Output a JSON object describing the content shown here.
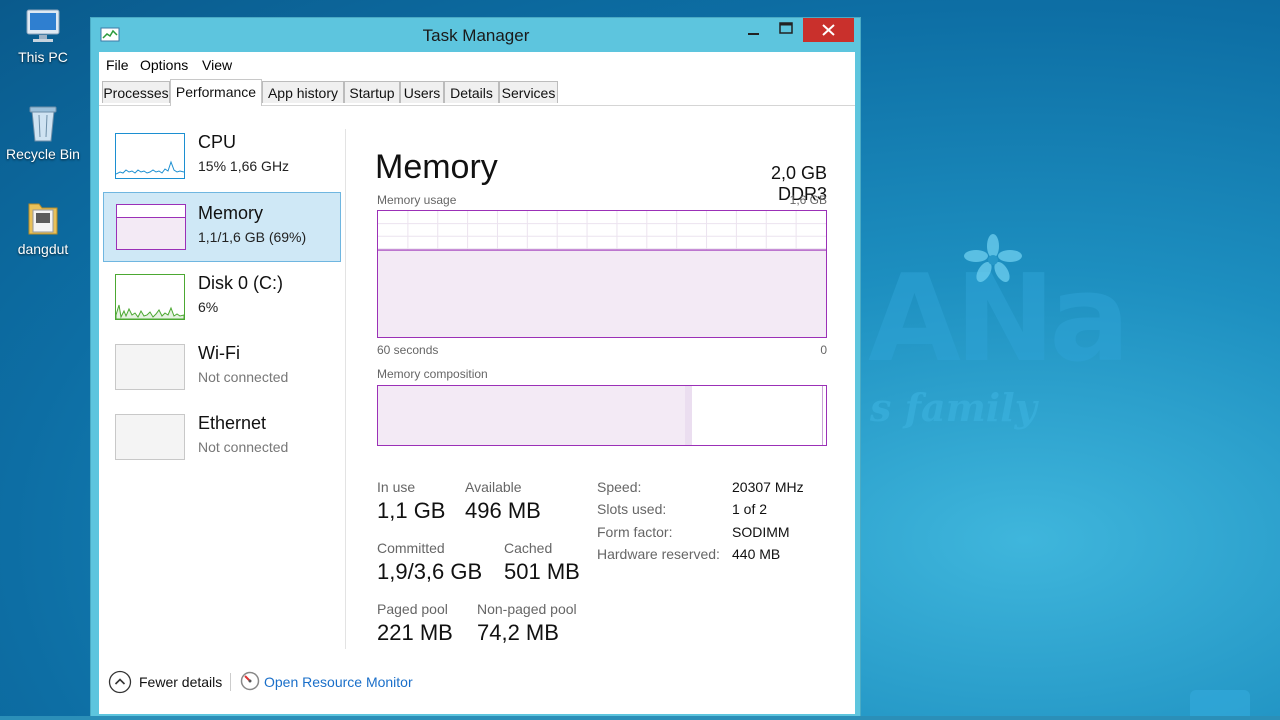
{
  "desktop": {
    "icons": [
      {
        "label": "This PC"
      },
      {
        "label": "Recycle Bin"
      },
      {
        "label": "dangdut"
      }
    ]
  },
  "window": {
    "title": "Task Manager",
    "menu": [
      "File",
      "Options",
      "View"
    ],
    "tabs": [
      "Processes",
      "Performance",
      "App history",
      "Startup",
      "Users",
      "Details",
      "Services"
    ],
    "active_tab": "Performance"
  },
  "sidebar": {
    "items": [
      {
        "title": "CPU",
        "subtitle": "15%  1,66 GHz"
      },
      {
        "title": "Memory",
        "subtitle": "1,1/1,6 GB (69%)"
      },
      {
        "title": "Disk 0 (C:)",
        "subtitle": "6%"
      },
      {
        "title": "Wi-Fi",
        "subtitle": "Not connected"
      },
      {
        "title": "Ethernet",
        "subtitle": "Not connected"
      }
    ],
    "selected": "Memory"
  },
  "memory": {
    "title": "Memory",
    "type": "2,0 GB DDR3",
    "usage_label": "Memory usage",
    "usage_max": "1,6 GB",
    "axis_left": "60 seconds",
    "axis_right": "0",
    "usage_fraction": 0.69,
    "composition_label": "Memory composition",
    "composition": {
      "in_use_fraction": 0.685,
      "modified_fraction": 0.015,
      "standby_fraction": 0.29
    },
    "stats": {
      "in_use_label": "In use",
      "in_use": "1,1 GB",
      "available_label": "Available",
      "available": "496 MB",
      "committed_label": "Committed",
      "committed": "1,9/3,6 GB",
      "cached_label": "Cached",
      "cached": "501 MB",
      "paged_label": "Paged pool",
      "paged": "221 MB",
      "nonpaged_label": "Non-paged pool",
      "nonpaged": "74,2 MB"
    },
    "props": {
      "speed_label": "Speed:",
      "speed": "20307 MHz",
      "slots_label": "Slots used:",
      "slots": "1 of 2",
      "form_label": "Form factor:",
      "form": "SODIMM",
      "reserved_label": "Hardware reserved:",
      "reserved": "440 MB"
    }
  },
  "footer": {
    "fewer_details": "Fewer details",
    "resource_monitor": "Open Resource Monitor"
  },
  "colors": {
    "memory_purple": "#9b30b7",
    "cpu_blue": "#1c8fd1",
    "disk_green": "#4ca832",
    "link_blue": "#1a6fc9"
  }
}
